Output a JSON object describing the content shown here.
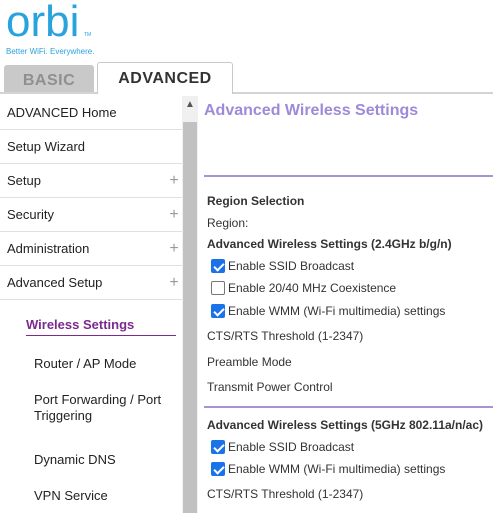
{
  "logo": {
    "word": "orbi",
    "tm": "TM",
    "tagline": "Better WiFi. Everywhere."
  },
  "tabs": {
    "basic": "BASIC",
    "advanced": "ADVANCED"
  },
  "sidebar": {
    "items": [
      {
        "label": "ADVANCED Home",
        "expand": ""
      },
      {
        "label": "Setup Wizard",
        "expand": ""
      },
      {
        "label": "Setup",
        "expand": "+"
      },
      {
        "label": "Security",
        "expand": "+"
      },
      {
        "label": "Administration",
        "expand": "+"
      },
      {
        "label": "Advanced Setup",
        "expand": "+"
      }
    ],
    "subitems": [
      {
        "label": "Wireless Settings",
        "active": true
      },
      {
        "label": "Router / AP Mode"
      },
      {
        "label": "Port Forwarding / Port Triggering"
      },
      {
        "label": "Dynamic DNS"
      },
      {
        "label": "VPN Service"
      }
    ]
  },
  "scrollbar": {
    "up_arrow": "▲"
  },
  "main": {
    "title": "Advanced Wireless Settings",
    "region_selection": "Region Selection",
    "region_label": "Region:",
    "band24": {
      "heading": "Advanced Wireless Settings (2.4GHz b/g/n)",
      "ssid_broadcast": {
        "label": "Enable SSID Broadcast",
        "checked": true
      },
      "coexistence": {
        "label": "Enable 20/40 MHz Coexistence",
        "checked": false
      },
      "wmm": {
        "label": "Enable WMM (Wi-Fi multimedia) settings",
        "checked": true
      },
      "cts_rts": "CTS/RTS Threshold (1-2347)",
      "preamble": "Preamble Mode",
      "tx_power": "Transmit Power Control"
    },
    "band5": {
      "heading": "Advanced Wireless Settings (5GHz 802.11a/n/ac)",
      "ssid_broadcast": {
        "label": "Enable SSID Broadcast",
        "checked": true
      },
      "wmm": {
        "label": "Enable WMM (Wi-Fi multimedia) settings",
        "checked": true
      },
      "cts_rts": "CTS/RTS Threshold (1-2347)"
    }
  },
  "colors": {
    "brand": "#29a3dc",
    "title": "#9e8ad8",
    "active_sub": "#7b2a8e",
    "checkbox": "#1a73e8"
  }
}
